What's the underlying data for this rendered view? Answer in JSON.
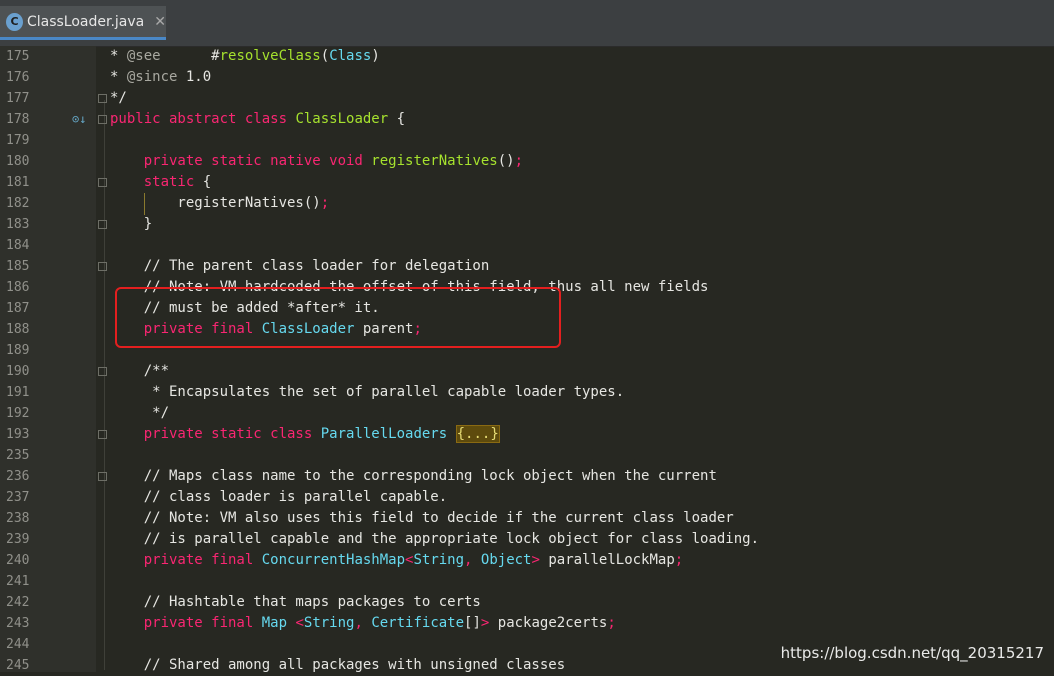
{
  "tab": {
    "icon_letter": "C",
    "label": "ClassLoader.java",
    "close_glyph": "✕"
  },
  "watermark": "https://blog.csdn.net/qq_20315217",
  "lines": [
    {
      "num": "175",
      "marker": "",
      "fold": false,
      "tokens": [
        [
          "cm",
          "* "
        ],
        [
          "ann",
          "@see"
        ],
        [
          "cm",
          "      #"
        ],
        [
          "fn",
          "resolveClass"
        ],
        [
          "cm",
          "("
        ],
        [
          "ty",
          "Class"
        ],
        [
          "cm",
          ")"
        ]
      ]
    },
    {
      "num": "176",
      "marker": "",
      "fold": false,
      "tokens": [
        [
          "cm",
          "* "
        ],
        [
          "ann",
          "@since"
        ],
        [
          "cm",
          " 1.0"
        ]
      ]
    },
    {
      "num": "177",
      "marker": "",
      "fold": true,
      "tokens": [
        [
          "cm",
          "*/"
        ]
      ]
    },
    {
      "num": "178",
      "marker": "⊙↓",
      "fold": true,
      "tokens": [
        [
          "kw",
          "public abstract class "
        ],
        [
          "fn",
          "ClassLoader"
        ],
        [
          "cm",
          " {"
        ]
      ]
    },
    {
      "num": "179",
      "marker": "",
      "fold": false,
      "tokens": []
    },
    {
      "num": "180",
      "marker": "",
      "fold": false,
      "tokens": [
        [
          "cm",
          "    "
        ],
        [
          "kw",
          "private static native void "
        ],
        [
          "fn",
          "registerNatives"
        ],
        [
          "cm",
          "()"
        ],
        [
          "kw",
          ";"
        ]
      ]
    },
    {
      "num": "181",
      "marker": "",
      "fold": true,
      "tokens": [
        [
          "cm",
          "    "
        ],
        [
          "kw",
          "static"
        ],
        [
          "cm",
          " {"
        ]
      ]
    },
    {
      "num": "182",
      "marker": "",
      "fold": false,
      "tokens": [
        [
          "cm",
          "        registerNatives()"
        ],
        [
          "kw",
          ";"
        ]
      ]
    },
    {
      "num": "183",
      "marker": "",
      "fold": true,
      "tokens": [
        [
          "cm",
          "    }"
        ]
      ]
    },
    {
      "num": "184",
      "marker": "",
      "fold": false,
      "tokens": []
    },
    {
      "num": "185",
      "marker": "",
      "fold": true,
      "tokens": [
        [
          "cm",
          "    // The parent class loader for delegation"
        ]
      ]
    },
    {
      "num": "186",
      "marker": "",
      "fold": false,
      "tokens": [
        [
          "cm",
          "    // Note: VM hardcoded the offset of this field, thus all new fields"
        ]
      ]
    },
    {
      "num": "187",
      "marker": "",
      "fold": false,
      "tokens": [
        [
          "cm",
          "    // must be added *after* it."
        ]
      ]
    },
    {
      "num": "188",
      "marker": "",
      "fold": false,
      "tokens": [
        [
          "cm",
          "    "
        ],
        [
          "kw",
          "private final "
        ],
        [
          "ty",
          "ClassLoader"
        ],
        [
          "cm",
          " parent"
        ],
        [
          "kw",
          ";"
        ]
      ]
    },
    {
      "num": "189",
      "marker": "",
      "fold": false,
      "tokens": []
    },
    {
      "num": "190",
      "marker": "",
      "fold": true,
      "tokens": [
        [
          "cm",
          "    /**"
        ]
      ]
    },
    {
      "num": "191",
      "marker": "",
      "fold": false,
      "tokens": [
        [
          "cm",
          "     * Encapsulates the set of parallel capable loader types."
        ]
      ]
    },
    {
      "num": "192",
      "marker": "",
      "fold": false,
      "tokens": [
        [
          "cm",
          "     */"
        ]
      ]
    },
    {
      "num": "193",
      "marker": "",
      "fold": true,
      "tokens": [
        [
          "cm",
          "    "
        ],
        [
          "kw",
          "private static class "
        ],
        [
          "ty",
          "ParallelLoaders"
        ],
        [
          "cm",
          " "
        ],
        [
          "fold",
          "{...}"
        ]
      ]
    },
    {
      "num": "235",
      "marker": "",
      "fold": false,
      "tokens": []
    },
    {
      "num": "236",
      "marker": "",
      "fold": true,
      "tokens": [
        [
          "cm",
          "    // Maps class name to the corresponding lock object when the current"
        ]
      ]
    },
    {
      "num": "237",
      "marker": "",
      "fold": false,
      "tokens": [
        [
          "cm",
          "    // class loader is parallel capable."
        ]
      ]
    },
    {
      "num": "238",
      "marker": "",
      "fold": false,
      "tokens": [
        [
          "cm",
          "    // Note: VM also uses this field to decide if the current class loader"
        ]
      ]
    },
    {
      "num": "239",
      "marker": "",
      "fold": false,
      "tokens": [
        [
          "cm",
          "    // is parallel capable and the appropriate lock object for class loading."
        ]
      ]
    },
    {
      "num": "240",
      "marker": "",
      "fold": false,
      "tokens": [
        [
          "cm",
          "    "
        ],
        [
          "kw",
          "private final "
        ],
        [
          "ty",
          "ConcurrentHashMap"
        ],
        [
          "kw",
          "<"
        ],
        [
          "ty",
          "String"
        ],
        [
          "kw",
          ", "
        ],
        [
          "ty",
          "Object"
        ],
        [
          "kw",
          "> "
        ],
        [
          "cm",
          "parallelLockMap"
        ],
        [
          "kw",
          ";"
        ]
      ]
    },
    {
      "num": "241",
      "marker": "",
      "fold": false,
      "tokens": []
    },
    {
      "num": "242",
      "marker": "",
      "fold": false,
      "tokens": [
        [
          "cm",
          "    // Hashtable that maps packages to certs"
        ]
      ]
    },
    {
      "num": "243",
      "marker": "",
      "fold": false,
      "tokens": [
        [
          "cm",
          "    "
        ],
        [
          "kw",
          "private final "
        ],
        [
          "ty",
          "Map"
        ],
        [
          "kw",
          " <"
        ],
        [
          "ty",
          "String"
        ],
        [
          "kw",
          ", "
        ],
        [
          "ty",
          "Certificate"
        ],
        [
          "cm",
          "[]"
        ],
        [
          "kw",
          "> "
        ],
        [
          "cm",
          "package2certs"
        ],
        [
          "kw",
          ";"
        ]
      ]
    },
    {
      "num": "244",
      "marker": "",
      "fold": false,
      "tokens": []
    },
    {
      "num": "245",
      "marker": "",
      "fold": false,
      "tokens": [
        [
          "cm",
          "    // Shared among all packages with unsigned classes"
        ]
      ]
    }
  ]
}
